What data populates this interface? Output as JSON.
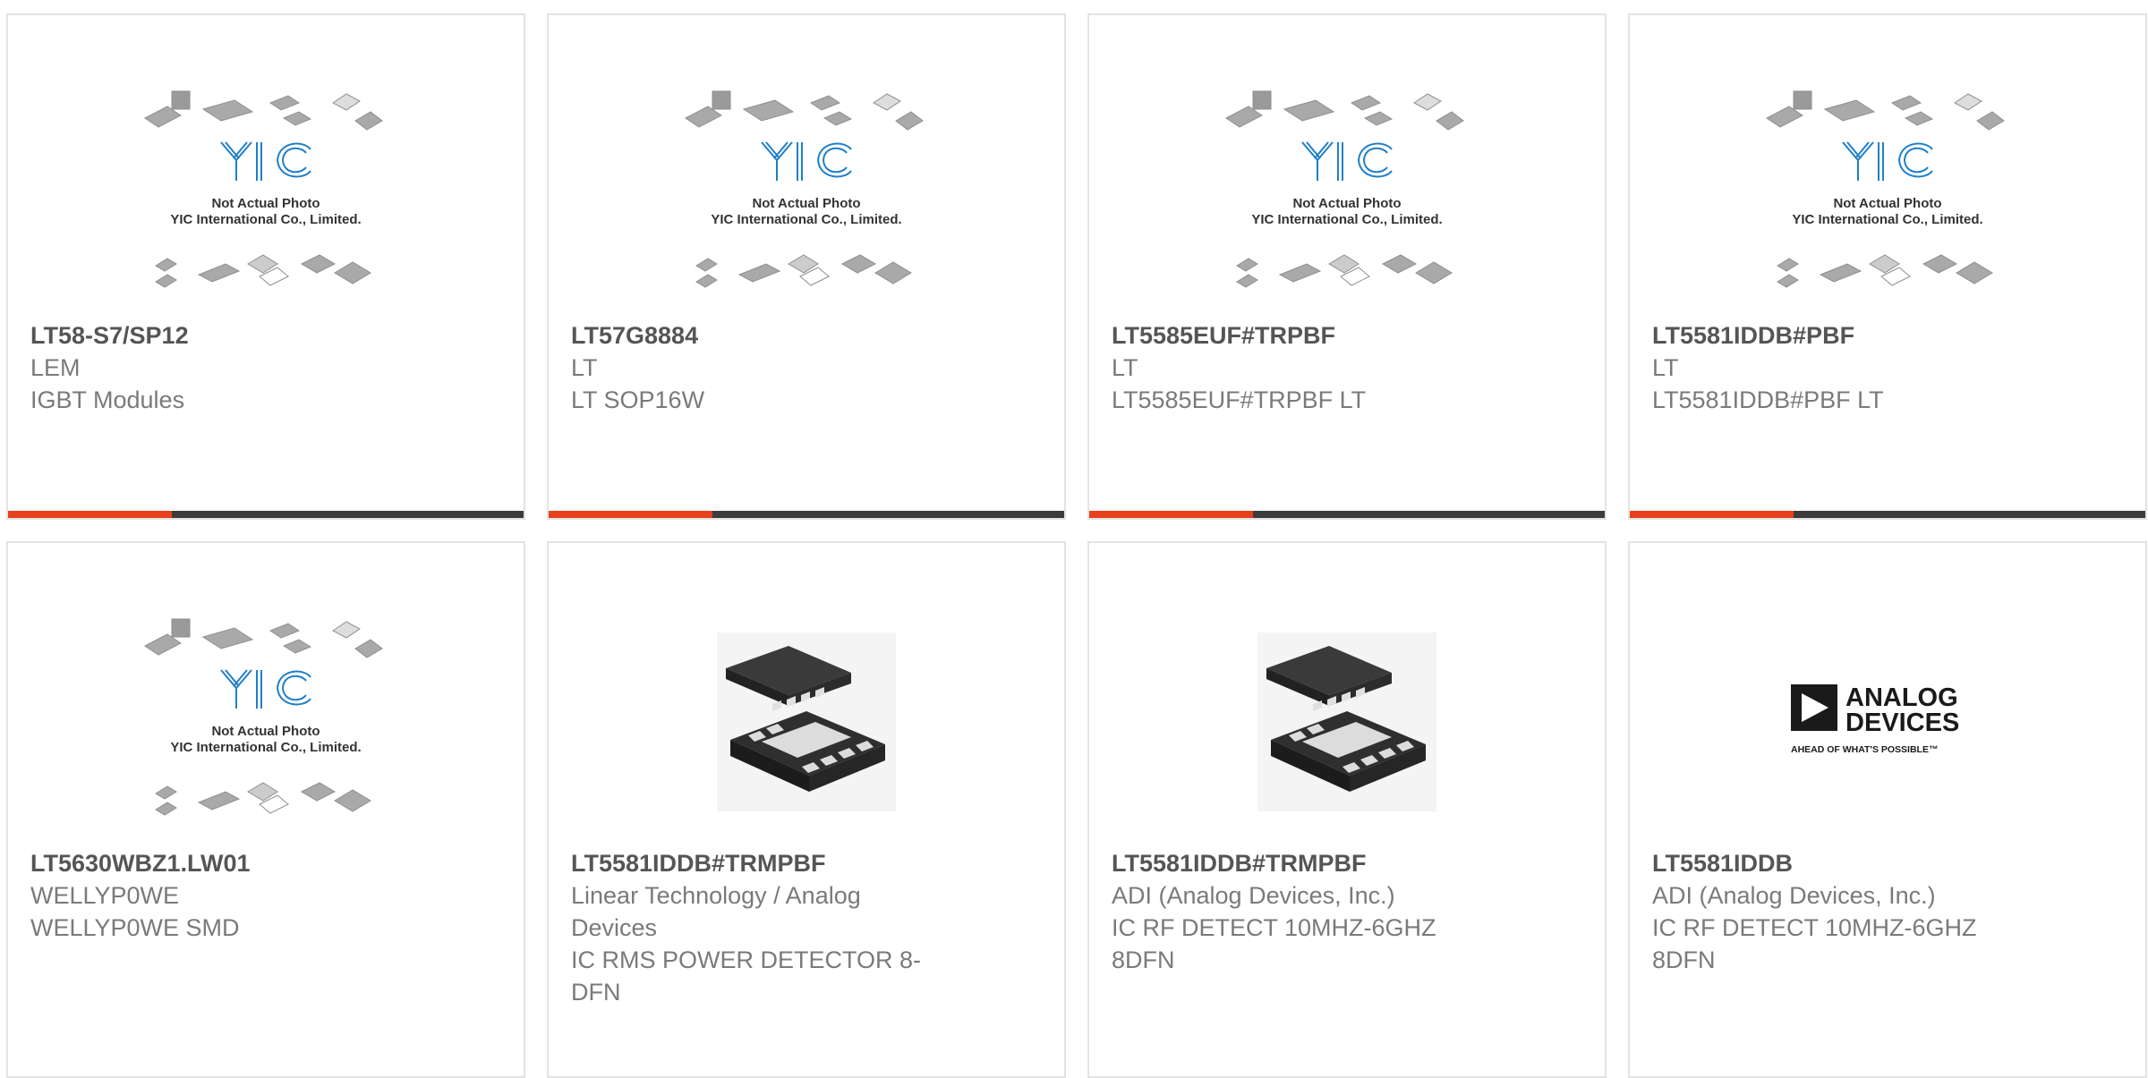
{
  "products": [
    {
      "part_number": "LT58-S7/SP12",
      "manufacturer": "LEM",
      "description": "IGBT Modules",
      "image": "yic-placeholder",
      "image_text": [
        "Not Actual Photo",
        "YIC International Co., Limited."
      ],
      "logo_text": "YIC"
    },
    {
      "part_number": "LT57G8884",
      "manufacturer": "LT",
      "description": "LT SOP16W",
      "image": "yic-placeholder",
      "image_text": [
        "Not Actual Photo",
        "YIC International Co., Limited."
      ],
      "logo_text": "YIC"
    },
    {
      "part_number": "LT5585EUF#TRPBF",
      "manufacturer": "LT",
      "description": "LT5585EUF#TRPBF LT",
      "image": "yic-placeholder",
      "image_text": [
        "Not Actual Photo",
        "YIC International Co., Limited."
      ],
      "logo_text": "YIC"
    },
    {
      "part_number": "LT5581IDDB#PBF",
      "manufacturer": "LT",
      "description": "LT5581IDDB#PBF LT",
      "image": "yic-placeholder",
      "image_text": [
        "Not Actual Photo",
        "YIC International Co., Limited."
      ],
      "logo_text": "YIC"
    },
    {
      "part_number": "LT5630WBZ1.LW01",
      "manufacturer": "WELLYP0WE",
      "description": "WELLYP0WE SMD",
      "image": "yic-placeholder",
      "image_text": [
        "Not Actual Photo",
        "YIC International Co., Limited."
      ],
      "logo_text": "YIC"
    },
    {
      "part_number": "LT5581IDDB#TRMPBF",
      "manufacturer": "Linear Technology / Analog Devices",
      "description": "IC RMS POWER DETECTOR 8-DFN",
      "image": "dfn-package"
    },
    {
      "part_number": "LT5581IDDB#TRMPBF",
      "manufacturer": "ADI (Analog Devices, Inc.)",
      "description": "IC RF DETECT 10MHZ-6GHZ 8DFN",
      "image": "dfn-package"
    },
    {
      "part_number": "LT5581IDDB",
      "manufacturer": "ADI (Analog Devices, Inc.)",
      "description": "IC RF DETECT 10MHZ-6GHZ 8DFN",
      "image": "adi-logo",
      "logo_line1": "ANALOG",
      "logo_line2": "DEVICES",
      "tagline": "AHEAD OF WHAT'S POSSIBLE™"
    }
  ],
  "colors": {
    "accent": "#e8401c",
    "bar": "#3c3c3c",
    "part_number": "#555555",
    "secondary_text": "#7a7a7a",
    "yic_blue": "#1f7fc7"
  }
}
